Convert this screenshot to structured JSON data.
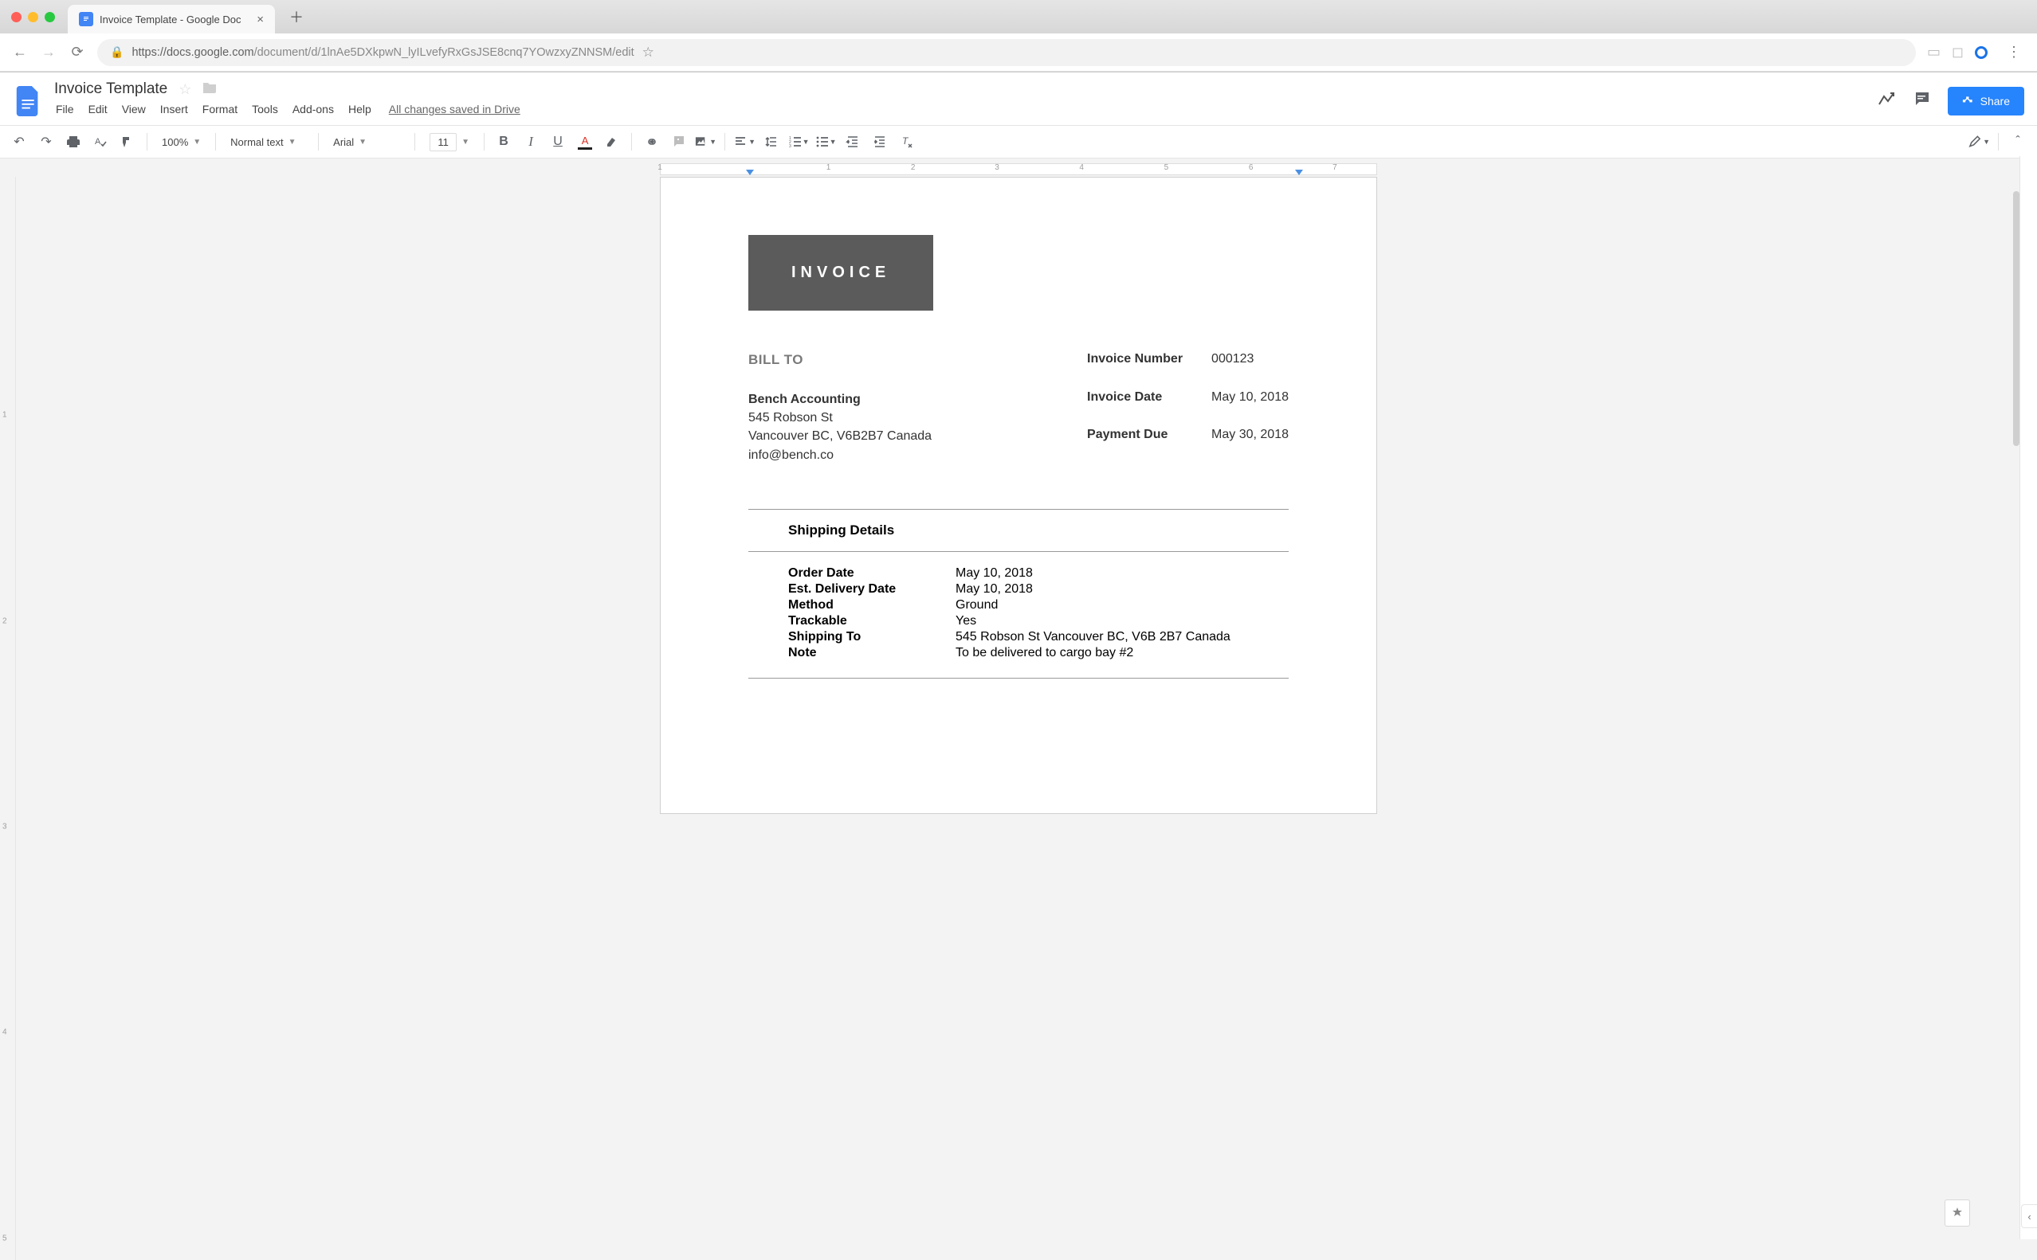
{
  "browser": {
    "tab_title": "Invoice Template - Google Doc",
    "url_proto": "https://",
    "url_host": "docs.google.com",
    "url_path": "/document/d/1lnAe5DXkpwN_lyILvefyRxGsJSE8cnq7YOwzxyZNNSM/edit"
  },
  "docs": {
    "title": "Invoice Template",
    "menu": [
      "File",
      "Edit",
      "View",
      "Insert",
      "Format",
      "Tools",
      "Add-ons",
      "Help"
    ],
    "save_status": "All changes saved in Drive",
    "share_label": "Share"
  },
  "toolbar": {
    "zoom": "100%",
    "style": "Normal text",
    "font": "Arial",
    "size": "11"
  },
  "ruler": {
    "ticks": [
      "1",
      "1",
      "2",
      "3",
      "4",
      "5",
      "6",
      "7"
    ]
  },
  "vruler": [
    "1",
    "2",
    "3",
    "4",
    "5"
  ],
  "doc": {
    "banner": "INVOICE",
    "bill_to_title": "BILL TO",
    "bill_to": {
      "company": "Bench Accounting",
      "addr1": "545 Robson St",
      "addr2": "Vancouver BC, V6B2B7 Canada",
      "email": "info@bench.co"
    },
    "meta_labels": [
      "Invoice Number",
      "Invoice Date",
      "Payment Due"
    ],
    "meta_values": [
      "000123",
      "May 10, 2018",
      "May 30, 2018"
    ],
    "shipping_title": "Shipping Details",
    "ship_labels": [
      "Order Date",
      "Est. Delivery Date",
      "Method",
      "Trackable",
      "Shipping To",
      "Note"
    ],
    "ship_values": [
      "May 10, 2018",
      "May 10, 2018",
      "Ground",
      "Yes",
      "545 Robson St Vancouver BC, V6B 2B7 Canada",
      "To be delivered to cargo bay #2"
    ]
  }
}
